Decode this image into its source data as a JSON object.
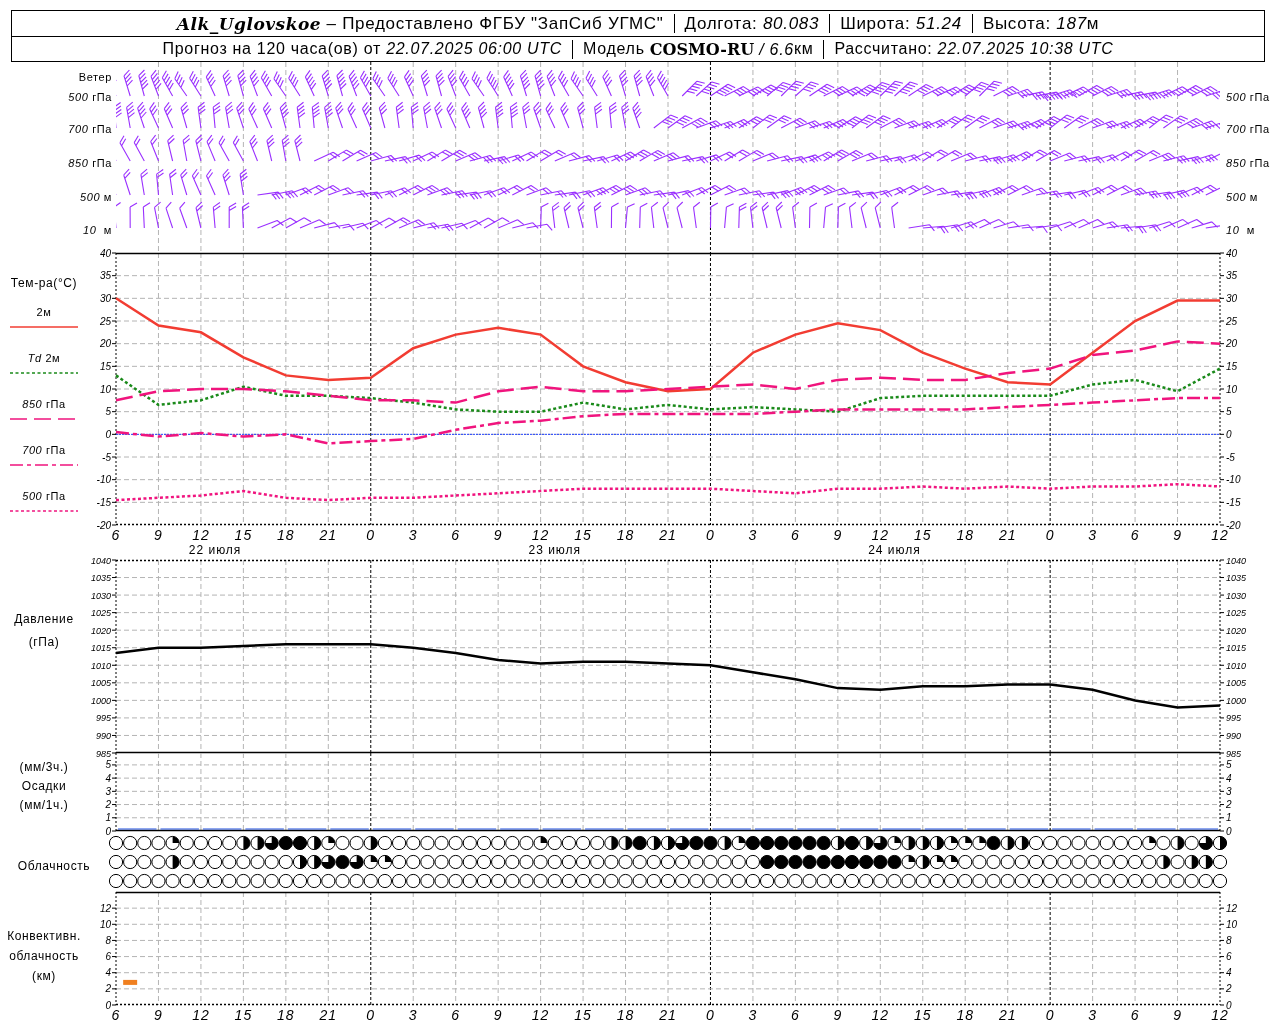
{
  "header": {
    "station": "Alk_Uglovskoe",
    "provider": "– Предоставлено ФГБУ \"ЗапСиб УГМС\"",
    "fields": [
      {
        "label": "Долгота:",
        "value": "80.083"
      },
      {
        "label": "Широта:",
        "value": "51.24"
      },
      {
        "label": "Высота:",
        "value": "187",
        "unit": "м"
      }
    ],
    "forecast": [
      {
        "label": "Прогноз на 120 часа(ов) от",
        "value": "22.07.2025 06:00 UTC"
      },
      {
        "label": "Модель",
        "value": "**COSMO-RU** / 6.6",
        "unit": "км"
      },
      {
        "label": "Рассчитано:",
        "value": "22.07.2025 10:38 UTC"
      }
    ]
  },
  "wind": {
    "title": "Ветер",
    "levels": [
      {
        "label": "*500* гПа",
        "right_label": "*500* гПа"
      },
      {
        "label": "*700* гПа",
        "right_label": "*700* гПа"
      },
      {
        "label": "*850* гПа",
        "right_label": "*850* гПа"
      },
      {
        "label": "*500* м",
        "right_label": "*500* м"
      },
      {
        "label": "*10*  м",
        "right_label": "*10*  м"
      }
    ]
  },
  "temperature": {
    "chart_data": {
      "type": "line",
      "ylabel": "Тем-ра(°С)",
      "grid": true,
      "categories": [
        "6",
        "9",
        "12",
        "15",
        "18",
        "21",
        "0",
        "3",
        "6",
        "9",
        "12",
        "15",
        "18",
        "21",
        "0",
        "3",
        "6",
        "9",
        "12",
        "15",
        "18",
        "21",
        "0",
        "3",
        "6",
        "9",
        "12"
      ],
      "ylim": [
        -20,
        40
      ],
      "yticks": [
        -20,
        -15,
        -10,
        -5,
        0,
        5,
        10,
        15,
        20,
        25,
        30,
        35,
        40
      ],
      "y2lim": [
        -20,
        40
      ],
      "y2ticks": [
        -20,
        -15,
        -10,
        -5,
        0,
        5,
        10,
        15,
        20,
        25,
        30,
        35,
        40
      ],
      "ref_lines": [
        {
          "axis": "y",
          "value": 0,
          "color": "#2040ff"
        }
      ],
      "series": [
        {
          "name": "2м",
          "color": "#f23c32",
          "line_style": "solid",
          "values": [
            30,
            24,
            22.5,
            17,
            13,
            12,
            12.5,
            19,
            22,
            23.5,
            22,
            15,
            11.5,
            9.5,
            10,
            18,
            22,
            24.5,
            23,
            18,
            14.5,
            11.5,
            11,
            18,
            25,
            29.5,
            29.5
          ]
        },
        {
          "name": "*Td* 2м",
          "color": "#1a8a1a",
          "line_style": "dotted",
          "values": [
            13,
            6.5,
            7.5,
            10.5,
            8.5,
            8.5,
            8,
            7,
            5.5,
            5,
            5,
            7,
            5.5,
            6.5,
            5.5,
            6,
            5.5,
            5,
            8,
            8.5,
            8.5,
            8.5,
            8.5,
            11,
            12,
            9.5,
            14.5
          ]
        },
        {
          "name": "*850* гПа",
          "color": "#f0147d",
          "line_style": "dashed",
          "values": [
            7.5,
            9.5,
            10,
            10,
            9.5,
            8.5,
            7.5,
            7.5,
            7,
            9.5,
            10.5,
            9.5,
            9.5,
            10,
            10.5,
            11,
            10,
            12,
            12.5,
            12,
            12,
            13.5,
            14.5,
            17.5,
            18.5,
            20.5,
            20
          ]
        },
        {
          "name": "*700* гПа",
          "color": "#f0147e",
          "line_style": "dashdot",
          "values": [
            0.5,
            -0.5,
            0.3,
            -0.5,
            0,
            -2,
            -1.5,
            -1,
            1,
            2.5,
            3,
            4,
            4.5,
            4.5,
            4.5,
            4.5,
            5,
            5.5,
            5.5,
            5.5,
            5.5,
            6,
            6.5,
            7,
            7.5,
            8,
            8
          ]
        },
        {
          "name": "*500* гПа",
          "color": "#f0147f",
          "line_style": "dotted",
          "values": [
            -14.5,
            -14,
            -13.5,
            -12.5,
            -14,
            -14.5,
            -14,
            -14,
            -13.5,
            -13,
            -12.5,
            -12,
            -12,
            -12,
            -12,
            -12.5,
            -13,
            -12,
            -12,
            -11.5,
            -12,
            -11.5,
            -12,
            -11.5,
            -11.5,
            -11,
            -11.5
          ]
        }
      ]
    },
    "dates": [
      {
        "label": "22 июля"
      },
      {
        "label": "23 июля"
      },
      {
        "label": "24 июля"
      }
    ]
  },
  "pressure": {
    "chart_data": {
      "type": "line",
      "ylabel": "Давление (гПа)",
      "grid": true,
      "categories": [
        null,
        null,
        null,
        null,
        null,
        null,
        null,
        null,
        null,
        null,
        null,
        null,
        null,
        null,
        null,
        null,
        null,
        null,
        null,
        null,
        null,
        null,
        null,
        null,
        null,
        null,
        null
      ],
      "ylim": [
        985,
        1040
      ],
      "yticks": [
        985,
        990,
        995,
        1000,
        1005,
        1010,
        1015,
        1020,
        1025,
        1030,
        1035,
        1040
      ],
      "y2lim": [
        985,
        1040
      ],
      "y2ticks": [
        985,
        990,
        995,
        1000,
        1005,
        1010,
        1015,
        1020,
        1025,
        1030,
        1035,
        1040
      ],
      "series": [
        {
          "color": "#000000",
          "line_style": "solid",
          "values": [
            1013.5,
            1015,
            1015,
            1015.5,
            1016,
            1016,
            1016,
            1015,
            1013.5,
            1011.5,
            1010.5,
            1011,
            1011,
            1010.5,
            1010,
            1008,
            1006,
            1003.5,
            1003,
            1004,
            1004,
            1004.5,
            1004.5,
            1003,
            1000,
            998,
            998.5
          ]
        }
      ]
    }
  },
  "precipitation": {
    "chart_data": {
      "type": "bar",
      "ylabel": "(мм/3ч.) Осадки (мм/1ч.)",
      "grid": true,
      "categories": [
        null,
        null,
        null,
        null,
        null,
        null,
        null,
        null,
        null,
        null,
        null,
        null,
        null,
        null,
        null,
        null,
        null,
        null,
        null,
        null,
        null,
        null,
        null,
        null,
        null,
        null
      ],
      "series": [
        {
          "values": [
            0,
            0,
            0,
            0,
            0,
            0,
            0,
            0,
            0,
            0,
            0,
            0,
            0,
            0,
            0,
            0,
            0,
            0,
            0,
            0,
            0,
            0,
            0,
            0,
            0,
            0
          ]
        }
      ],
      "ylim": [
        0,
        5.9
      ],
      "yticks": [
        0,
        1,
        2,
        3,
        4,
        5
      ],
      "y2lim": [
        0,
        5.9
      ],
      "y2ticks": [
        0,
        1,
        2,
        3,
        4,
        5
      ]
    }
  },
  "cloudiness": {
    "label": "Облачность",
    "rows": [
      {
        "cells": [
          {
            "kind": "clear"
          },
          {
            "kind": "clear"
          },
          {
            "kind": "clear"
          },
          {
            "kind": "clear"
          },
          {
            "kind": "quarter"
          },
          {
            "kind": "clear"
          },
          {
            "kind": "clear"
          },
          {
            "kind": "clear"
          },
          {
            "kind": "clear"
          },
          {
            "kind": "half"
          },
          {
            "kind": "half"
          },
          {
            "kind": "most"
          },
          {
            "kind": "overcast"
          },
          {
            "kind": "overcast"
          },
          {
            "kind": "half"
          },
          {
            "kind": "quarter"
          },
          {
            "kind": "clear"
          },
          {
            "kind": "clear"
          },
          {
            "kind": "half"
          },
          {
            "kind": "clear"
          },
          {
            "kind": "clear"
          },
          {
            "kind": "clear"
          },
          {
            "kind": "clear"
          },
          {
            "kind": "clear"
          },
          {
            "kind": "clear"
          },
          {
            "kind": "clear"
          },
          {
            "kind": "clear"
          },
          {
            "kind": "clear"
          },
          {
            "kind": "clear"
          },
          {
            "kind": "clear"
          },
          {
            "kind": "quarter"
          },
          {
            "kind": "clear"
          },
          {
            "kind": "clear"
          },
          {
            "kind": "clear"
          },
          {
            "kind": "clear"
          },
          {
            "kind": "half"
          },
          {
            "kind": "half"
          },
          {
            "kind": "overcast"
          },
          {
            "kind": "half"
          },
          {
            "kind": "half"
          },
          {
            "kind": "most"
          },
          {
            "kind": "overcast"
          },
          {
            "kind": "overcast"
          },
          {
            "kind": "half"
          },
          {
            "kind": "quarter"
          },
          {
            "kind": "overcast"
          },
          {
            "kind": "overcast"
          },
          {
            "kind": "overcast"
          },
          {
            "kind": "overcast"
          },
          {
            "kind": "overcast"
          },
          {
            "kind": "overcast"
          },
          {
            "kind": "half"
          },
          {
            "kind": "overcast"
          },
          {
            "kind": "half"
          },
          {
            "kind": "most"
          },
          {
            "kind": "quarter"
          },
          {
            "kind": "half"
          },
          {
            "kind": "half"
          },
          {
            "kind": "half"
          },
          {
            "kind": "quarter"
          },
          {
            "kind": "quarter"
          },
          {
            "kind": "quarter"
          },
          {
            "kind": "overcast"
          },
          {
            "kind": "half"
          },
          {
            "kind": "half"
          },
          {
            "kind": "clear"
          },
          {
            "kind": "clear"
          },
          {
            "kind": "clear"
          },
          {
            "kind": "clear"
          },
          {
            "kind": "clear"
          },
          {
            "kind": "clear"
          },
          {
            "kind": "clear"
          },
          {
            "kind": "clear"
          },
          {
            "kind": "quarter"
          },
          {
            "kind": "clear"
          },
          {
            "kind": "half"
          },
          {
            "kind": "clear"
          },
          {
            "kind": "most"
          },
          {
            "kind": "half"
          }
        ]
      },
      {
        "cells": [
          {
            "kind": "clear"
          },
          {
            "kind": "clear"
          },
          {
            "kind": "clear"
          },
          {
            "kind": "clear"
          },
          {
            "kind": "half"
          },
          {
            "kind": "clear"
          },
          {
            "kind": "clear"
          },
          {
            "kind": "clear"
          },
          {
            "kind": "clear"
          },
          {
            "kind": "clear"
          },
          {
            "kind": "clear"
          },
          {
            "kind": "clear"
          },
          {
            "kind": "clear"
          },
          {
            "kind": "half"
          },
          {
            "kind": "half"
          },
          {
            "kind": "most"
          },
          {
            "kind": "overcast"
          },
          {
            "kind": "most"
          },
          {
            "kind": "quarter"
          },
          {
            "kind": "quarter"
          },
          {
            "kind": "clear"
          },
          {
            "kind": "clear"
          },
          {
            "kind": "clear"
          },
          {
            "kind": "clear"
          },
          {
            "kind": "clear"
          },
          {
            "kind": "clear"
          },
          {
            "kind": "clear"
          },
          {
            "kind": "clear"
          },
          {
            "kind": "clear"
          },
          {
            "kind": "clear"
          },
          {
            "kind": "clear"
          },
          {
            "kind": "clear"
          },
          {
            "kind": "clear"
          },
          {
            "kind": "clear"
          },
          {
            "kind": "clear"
          },
          {
            "kind": "clear"
          },
          {
            "kind": "clear"
          },
          {
            "kind": "clear"
          },
          {
            "kind": "clear"
          },
          {
            "kind": "clear"
          },
          {
            "kind": "clear"
          },
          {
            "kind": "clear"
          },
          {
            "kind": "clear"
          },
          {
            "kind": "clear"
          },
          {
            "kind": "clear"
          },
          {
            "kind": "clear"
          },
          {
            "kind": "overcast"
          },
          {
            "kind": "overcast"
          },
          {
            "kind": "overcast"
          },
          {
            "kind": "overcast"
          },
          {
            "kind": "overcast"
          },
          {
            "kind": "overcast"
          },
          {
            "kind": "overcast"
          },
          {
            "kind": "overcast"
          },
          {
            "kind": "overcast"
          },
          {
            "kind": "overcast"
          },
          {
            "kind": "quarter"
          },
          {
            "kind": "half"
          },
          {
            "kind": "quarter"
          },
          {
            "kind": "quarter"
          },
          {
            "kind": "clear"
          },
          {
            "kind": "clear"
          },
          {
            "kind": "clear"
          },
          {
            "kind": "clear"
          },
          {
            "kind": "clear"
          },
          {
            "kind": "clear"
          },
          {
            "kind": "clear"
          },
          {
            "kind": "clear"
          },
          {
            "kind": "clear"
          },
          {
            "kind": "clear"
          },
          {
            "kind": "clear"
          },
          {
            "kind": "clear"
          },
          {
            "kind": "clear"
          },
          {
            "kind": "clear"
          },
          {
            "kind": "half"
          },
          {
            "kind": "clear"
          },
          {
            "kind": "half"
          },
          {
            "kind": "half"
          },
          {
            "kind": "clear"
          }
        ]
      },
      {
        "cells": [
          {
            "kind": "clear"
          },
          {
            "kind": "clear"
          },
          {
            "kind": "clear"
          },
          {
            "kind": "clear"
          },
          {
            "kind": "clear"
          },
          {
            "kind": "clear"
          },
          {
            "kind": "clear"
          },
          {
            "kind": "clear"
          },
          {
            "kind": "clear"
          },
          {
            "kind": "clear"
          },
          {
            "kind": "clear"
          },
          {
            "kind": "clear"
          },
          {
            "kind": "clear"
          },
          {
            "kind": "clear"
          },
          {
            "kind": "clear"
          },
          {
            "kind": "clear"
          },
          {
            "kind": "clear"
          },
          {
            "kind": "clear"
          },
          {
            "kind": "clear"
          },
          {
            "kind": "clear"
          },
          {
            "kind": "clear"
          },
          {
            "kind": "clear"
          },
          {
            "kind": "clear"
          },
          {
            "kind": "clear"
          },
          {
            "kind": "clear"
          },
          {
            "kind": "clear"
          },
          {
            "kind": "clear"
          },
          {
            "kind": "clear"
          },
          {
            "kind": "clear"
          },
          {
            "kind": "clear"
          },
          {
            "kind": "clear"
          },
          {
            "kind": "clear"
          },
          {
            "kind": "clear"
          },
          {
            "kind": "clear"
          },
          {
            "kind": "clear"
          },
          {
            "kind": "clear"
          },
          {
            "kind": "clear"
          },
          {
            "kind": "clear"
          },
          {
            "kind": "clear"
          },
          {
            "kind": "clear"
          },
          {
            "kind": "clear"
          },
          {
            "kind": "clear"
          },
          {
            "kind": "clear"
          },
          {
            "kind": "clear"
          },
          {
            "kind": "clear"
          },
          {
            "kind": "clear"
          },
          {
            "kind": "clear"
          },
          {
            "kind": "clear"
          },
          {
            "kind": "clear"
          },
          {
            "kind": "clear"
          },
          {
            "kind": "clear"
          },
          {
            "kind": "clear"
          },
          {
            "kind": "clear"
          },
          {
            "kind": "clear"
          },
          {
            "kind": "clear"
          },
          {
            "kind": "clear"
          },
          {
            "kind": "clear"
          },
          {
            "kind": "clear"
          },
          {
            "kind": "clear"
          },
          {
            "kind": "clear"
          },
          {
            "kind": "clear"
          },
          {
            "kind": "clear"
          },
          {
            "kind": "clear"
          },
          {
            "kind": "clear"
          },
          {
            "kind": "clear"
          },
          {
            "kind": "clear"
          },
          {
            "kind": "clear"
          },
          {
            "kind": "clear"
          },
          {
            "kind": "clear"
          },
          {
            "kind": "clear"
          },
          {
            "kind": "clear"
          },
          {
            "kind": "clear"
          },
          {
            "kind": "clear"
          },
          {
            "kind": "clear"
          },
          {
            "kind": "clear"
          },
          {
            "kind": "clear"
          },
          {
            "kind": "clear"
          },
          {
            "kind": "clear"
          },
          {
            "kind": "clear"
          }
        ]
      }
    ]
  },
  "convective": {
    "chart_data": {
      "type": "scatter",
      "ylabel": "Конвективн. облачность (км)",
      "grid": true,
      "categories": [
        "6",
        null,
        null,
        "9",
        null,
        null,
        "12",
        null,
        null,
        "15",
        null,
        null,
        "18",
        null,
        null,
        "21",
        null,
        null,
        "0",
        null,
        null,
        "3",
        null,
        null,
        "6",
        null,
        null,
        "9",
        null,
        null,
        "12",
        null,
        null,
        "15",
        null,
        null,
        "18",
        null,
        null,
        "21",
        null,
        null,
        "0",
        null,
        null,
        "3",
        null,
        null,
        "6",
        null,
        null,
        "9",
        null,
        null,
        "12",
        null,
        null,
        "15",
        null,
        null,
        "18",
        null,
        null,
        "21",
        null,
        null,
        "0",
        null,
        null,
        "3",
        null,
        null,
        "6",
        null,
        null,
        "9",
        null,
        null,
        "12"
      ],
      "ylim": [
        0,
        14
      ],
      "yticks": [
        0,
        2,
        4,
        6,
        8,
        10,
        12
      ],
      "y2lim": [
        0,
        14
      ],
      "y2ticks": [
        0,
        2,
        4,
        6,
        8,
        10,
        12
      ],
      "series": [
        {
          "color": "#f08020",
          "values": [
            null,
            2.8,
            null,
            null,
            null,
            null,
            null,
            null,
            null,
            null,
            null,
            null,
            null,
            null,
            null,
            null,
            null,
            null,
            null,
            null,
            null,
            null,
            null,
            null,
            null,
            null,
            null,
            null,
            null,
            null,
            null,
            null,
            null,
            null,
            null,
            null,
            null,
            null,
            null,
            null,
            null,
            null,
            null,
            null,
            null,
            null,
            null,
            null,
            null,
            null,
            null,
            null,
            null,
            null,
            null,
            null,
            null,
            null,
            null,
            null,
            null,
            null,
            null,
            null,
            null,
            null,
            null,
            null,
            null,
            null,
            null,
            null,
            null,
            null,
            null,
            null,
            null,
            null,
            null
          ]
        }
      ]
    }
  }
}
